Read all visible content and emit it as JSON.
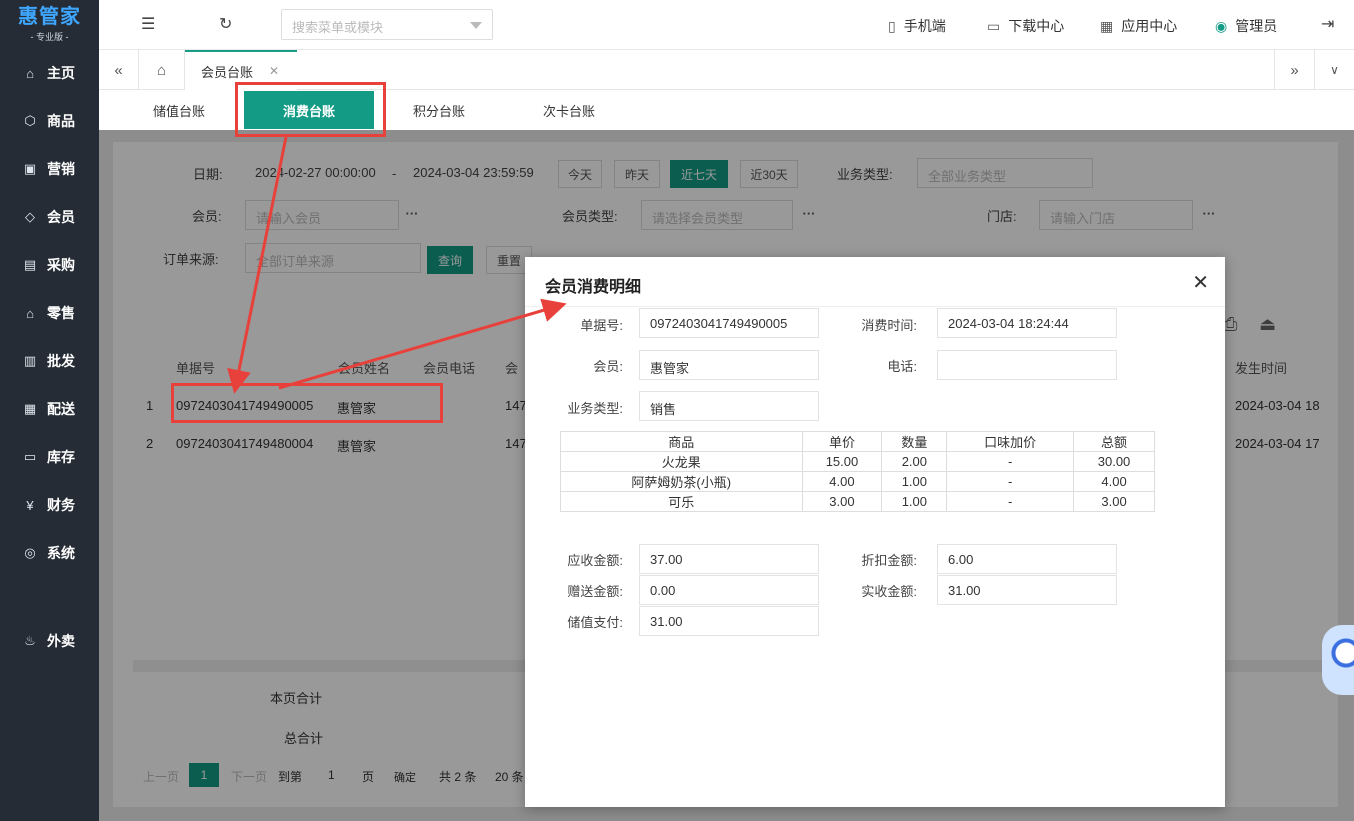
{
  "brand": {
    "title": "惠管家",
    "subtitle": "- 专业版 -"
  },
  "sidebar": {
    "items": [
      {
        "label": "主页",
        "icon": "home-icon",
        "glyph": "⌂"
      },
      {
        "label": "商品",
        "icon": "cube-icon",
        "glyph": "⬡"
      },
      {
        "label": "营销",
        "icon": "chart-icon",
        "glyph": "▣"
      },
      {
        "label": "会员",
        "icon": "diamond-icon",
        "glyph": "◇"
      },
      {
        "label": "采购",
        "icon": "purchase-icon",
        "glyph": "▤"
      },
      {
        "label": "零售",
        "icon": "bag-icon",
        "glyph": "⌂"
      },
      {
        "label": "批发",
        "icon": "building-icon",
        "glyph": "▥"
      },
      {
        "label": "配送",
        "icon": "delivery-icon",
        "glyph": "▦"
      },
      {
        "label": "库存",
        "icon": "inventory-icon",
        "glyph": "▭"
      },
      {
        "label": "财务",
        "icon": "yen-icon",
        "glyph": "¥"
      },
      {
        "label": "系统",
        "icon": "settings-icon",
        "glyph": "◎"
      },
      {
        "label": "外卖",
        "icon": "scooter-icon",
        "glyph": "♨"
      }
    ]
  },
  "topbar": {
    "search_placeholder": "搜索菜单或模块",
    "links": {
      "mobile": "手机端",
      "download": "下载中心",
      "apps": "应用中心",
      "user": "管理员"
    }
  },
  "tabs": {
    "active": "会员台账"
  },
  "subtabs": [
    "储值台账",
    "消费台账",
    "积分台账",
    "次卡台账"
  ],
  "filters": {
    "date_label": "日期:",
    "date_start": "2024-02-27 00:00:00",
    "date_sep": "-",
    "date_end": "2024-03-04 23:59:59",
    "quick": [
      "今天",
      "昨天",
      "近七天",
      "近30天"
    ],
    "biz_type_label": "业务类型:",
    "biz_type_value": "全部业务类型",
    "member_label": "会员:",
    "member_placeholder": "请输入会员",
    "member_type_label": "会员类型:",
    "member_type_placeholder": "请选择会员类型",
    "store_label": "门店:",
    "store_placeholder": "请输入门店",
    "source_label": "订单来源:",
    "source_value": "全部订单来源",
    "query": "查询",
    "reset": "重置"
  },
  "table": {
    "headers": [
      "单据号",
      "会员姓名",
      "会员电话",
      "会",
      "发生时间"
    ],
    "rows": [
      {
        "idx": "1",
        "order": "0972403041749490005",
        "name": "惠管家",
        "phone": "147",
        "time": "2024-03-04 18"
      },
      {
        "idx": "2",
        "order": "0972403041749480004",
        "name": "惠管家",
        "phone": "147",
        "time": "2024-03-04 17"
      }
    ],
    "page_total": "本页合计",
    "grand_total": "总合计"
  },
  "pager": {
    "prev": "上一页",
    "current": "1",
    "next": "下一页",
    "goto": "到第",
    "page_input": "1",
    "page_unit": "页",
    "confirm": "确定",
    "total": "共 2 条",
    "per_page": "20 条"
  },
  "modal": {
    "title": "会员消费明细",
    "order_label": "单据号:",
    "order_value": "0972403041749490005",
    "time_label": "消费时间:",
    "time_value": "2024-03-04 18:24:44",
    "member_label": "会员:",
    "member_value": "惠管家",
    "phone_label": "电话:",
    "phone_value": "",
    "biz_label": "业务类型:",
    "biz_value": "销售",
    "columns": [
      "商品",
      "单价",
      "数量",
      "口味加价",
      "总额"
    ],
    "items": [
      [
        "火龙果",
        "15.00",
        "2.00",
        "-",
        "30.00"
      ],
      [
        "阿萨姆奶茶(小瓶)",
        "4.00",
        "1.00",
        "-",
        "4.00"
      ],
      [
        "可乐",
        "3.00",
        "1.00",
        "-",
        "3.00"
      ]
    ],
    "receivable_label": "应收金额:",
    "receivable_value": "37.00",
    "discount_label": "折扣金额:",
    "discount_value": "6.00",
    "gift_label": "赠送金额:",
    "gift_value": "0.00",
    "actual_label": "实收金额:",
    "actual_value": "31.00",
    "stored_label": "储值支付:",
    "stored_value": "31.00"
  },
  "colors": {
    "accent": "#139b86",
    "sidebar": "#252c35",
    "annotation": "#e8403a"
  }
}
